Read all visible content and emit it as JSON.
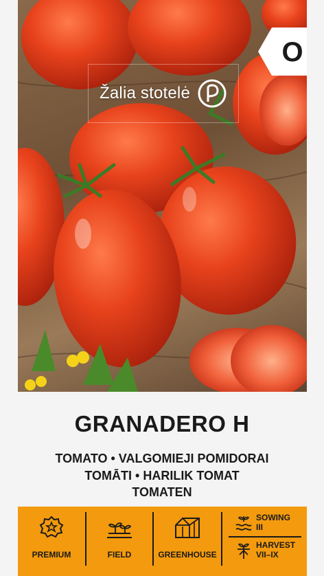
{
  "brand": {
    "name": "Žalia stotelė"
  },
  "badge": {
    "letter": "O"
  },
  "product": {
    "title": "GRANADERO H",
    "names_line1": "TOMATO • VALGOMIEJI POMIDORAI",
    "names_line2": "TOMĀTI • HARILIK TOMAT",
    "names_line3": "TOMATEN"
  },
  "features": {
    "premium": "PREMIUM",
    "field": "FIELD",
    "greenhouse": "GREENHOUSE",
    "sowing_label": "SOWING",
    "sowing_value": "III",
    "harvest_label": "HARVEST",
    "harvest_value": "VII–IX"
  },
  "colors": {
    "accent": "#f39a0e",
    "text": "#1a1a1a",
    "background": "#f4f4f4"
  }
}
